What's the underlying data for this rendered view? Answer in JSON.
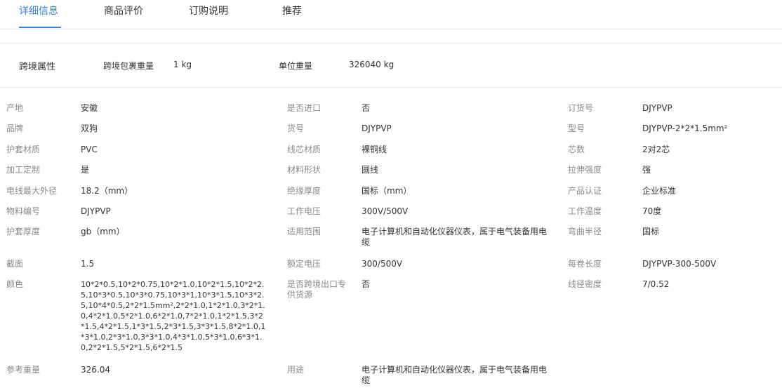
{
  "tabs": [
    "详细信息",
    "商品评价",
    "订购说明",
    "推荐"
  ],
  "cross_border": {
    "title": "跨境属性",
    "package_weight_label": "跨境包裹重量",
    "package_weight_value": "1 kg",
    "unit_weight_label": "单位重量",
    "unit_weight_value": "326040 kg"
  },
  "attributes": {
    "col1": [
      {
        "label": "产地",
        "value": "安徽"
      },
      {
        "label": "品牌",
        "value": "双狗"
      },
      {
        "label": "护套材质",
        "value": "PVC"
      },
      {
        "label": "加工定制",
        "value": "是"
      },
      {
        "label": "电线最大外径",
        "value": "18.2（mm）"
      },
      {
        "label": "物料编号",
        "value": "DJYPVP"
      },
      {
        "label": "护套厚度",
        "value": "gb（mm）"
      },
      {
        "label": "截面",
        "value": "1.5"
      },
      {
        "label": "颜色",
        "value": "10*2*0.5,10*2*0.75,10*2*1.0,10*2*1.5,10*2*2.5,10*3*0.5,10*3*0.75,10*3*1,10*3*1.5,10*3*2.5,10*4*0.5,2*2*1.5mm²,2*2*1.0,1*2*1.0,3*2*1.0,4*2*1.0,5*2*1.0,6*2*1.0,7*2*1.0,1*2*1.5,3*2*1.5,4*2*1.5,1*3*1.5,2*3*1.5,3*3*1.5,8*2*1.0,1*3*1.0,2*3*1.0,3*3*1.0,4*3*1.0,5*3*1.0,6*3*1.0,2*2*1.5,5*2*1.5,6*2*1.5"
      },
      {
        "label": "参考重量",
        "value": "326.04"
      }
    ],
    "col2": [
      {
        "label": "是否进口",
        "value": "否"
      },
      {
        "label": "货号",
        "value": "DJYPVP"
      },
      {
        "label": "线芯材质",
        "value": "裸铜线"
      },
      {
        "label": "材料形状",
        "value": "圆线"
      },
      {
        "label": "绝缘厚度",
        "value": "国标（mm）"
      },
      {
        "label": "工作电压",
        "value": "300V/500V"
      },
      {
        "label": "适用范围",
        "value": "电子计算机和自动化仪器仪表，属于电气装备用电缆"
      },
      {
        "label": "额定电压",
        "value": "300/500V"
      },
      {
        "label": "是否跨境出口专供货源",
        "value": "否"
      },
      {
        "label": "用途",
        "value": "电子计算机和自动化仪器仪表，属于电气装备用电缆"
      }
    ],
    "col3": [
      {
        "label": "订货号",
        "value": "DJYPVP"
      },
      {
        "label": "型号",
        "value": "DJYPVP-2*2*1.5mm²"
      },
      {
        "label": "芯数",
        "value": "2对2芯"
      },
      {
        "label": "拉伸强度",
        "value": "强"
      },
      {
        "label": "产品认证",
        "value": "企业标准"
      },
      {
        "label": "工作温度",
        "value": "70度"
      },
      {
        "label": "弯曲半径",
        "value": "国标"
      },
      {
        "label": "每卷长度",
        "value": "DJYPVP-300-500V"
      },
      {
        "label": "线径密度",
        "value": "7/0.52"
      }
    ]
  }
}
